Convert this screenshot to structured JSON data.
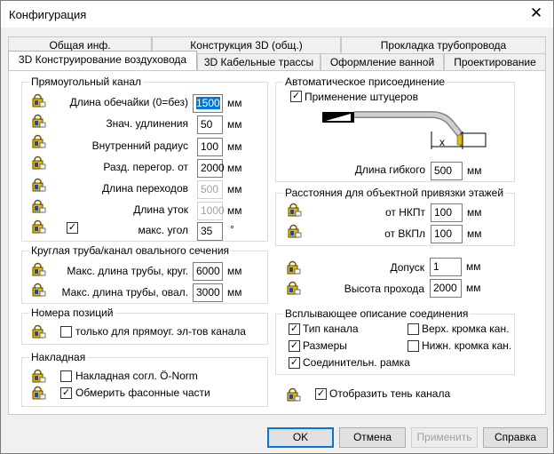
{
  "window": {
    "title": "Конфигурация",
    "close_glyph": "✕"
  },
  "tabs_row1": [
    "Общая инф.",
    "Конструкция 3D (общ.)",
    "Прокладка трубопровода"
  ],
  "tabs_row2": [
    "3D Конструирование воздуховода",
    "3D Кабельные трассы",
    "Оформление ванной",
    "Проектирование"
  ],
  "rect": {
    "title": "Прямоугольный канал",
    "len_label": "Длина обечайки (0=без)",
    "len_value": "1500",
    "len_unit": "мм",
    "ext_label": "Знач. удлинения",
    "ext_value": "50",
    "ext_unit": "мм",
    "rad_label": "Внутренний радиус",
    "rad_value": "100",
    "rad_unit": "мм",
    "part_label": "Разд. перегор. от",
    "part_value": "2000",
    "part_unit": "мм",
    "trans_label": "Длина переходов",
    "trans_value": "500",
    "trans_unit": "мм",
    "ut_label": "Длина уток",
    "ut_value": "1000",
    "ut_unit": "мм",
    "angle_label": "макс. угол",
    "angle_value": "35",
    "angle_unit": "°",
    "angle_checked": "✓"
  },
  "round": {
    "title": "Круглая труба/канал овального сечения",
    "circ_label": "Макс. длина трубы, круг.",
    "circ_value": "6000",
    "circ_unit": "мм",
    "oval_label": "Макс. длина трубы, овал.",
    "oval_value": "3000",
    "oval_unit": "мм"
  },
  "pos": {
    "title": "Номера позиций",
    "only_rect_label": "только для прямоуг. эл-тов канала",
    "only_rect_checked": ""
  },
  "overlay": {
    "title": "Накладная",
    "onorm_label": "Накладная согл. Ö-Norm",
    "onorm_checked": "",
    "measure_label": "Обмерить фасонные части",
    "measure_checked": "✓"
  },
  "auto": {
    "title": "Автоматическое присоединение",
    "fitting_label": "Применение штуцеров",
    "fitting_checked": "✓",
    "x_mark": "x",
    "flex_label": "Длина гибкого",
    "flex_value": "500",
    "flex_unit": "мм"
  },
  "floors": {
    "title": "Расстояния для объектной привязки этажей",
    "nkpt_label": "от НКПт",
    "nkpt_value": "100",
    "nkpt_unit": "мм",
    "vkpl_label": "от ВКПл",
    "vkpl_value": "100",
    "vkpl_unit": "мм"
  },
  "tol": {
    "label": "Допуск",
    "value": "1",
    "unit": "мм"
  },
  "pass": {
    "label": "Высота прохода",
    "value": "2000",
    "unit": "мм"
  },
  "popup": {
    "title": "Всплывающее описание соединения",
    "items": [
      {
        "label": "Тип канала",
        "checked": "✓"
      },
      {
        "label": "Верх. кромка кан.",
        "checked": ""
      },
      {
        "label": "Размеры",
        "checked": "✓"
      },
      {
        "label": "Нижн. кромка кан.",
        "checked": ""
      },
      {
        "label": "Соединительн. рамка",
        "checked": "✓"
      }
    ]
  },
  "shadow": {
    "label": "Отобразить тень канала",
    "checked": "✓"
  },
  "buttons": {
    "ok": "OK",
    "cancel": "Отмена",
    "apply": "Применить",
    "help": "Справка"
  }
}
